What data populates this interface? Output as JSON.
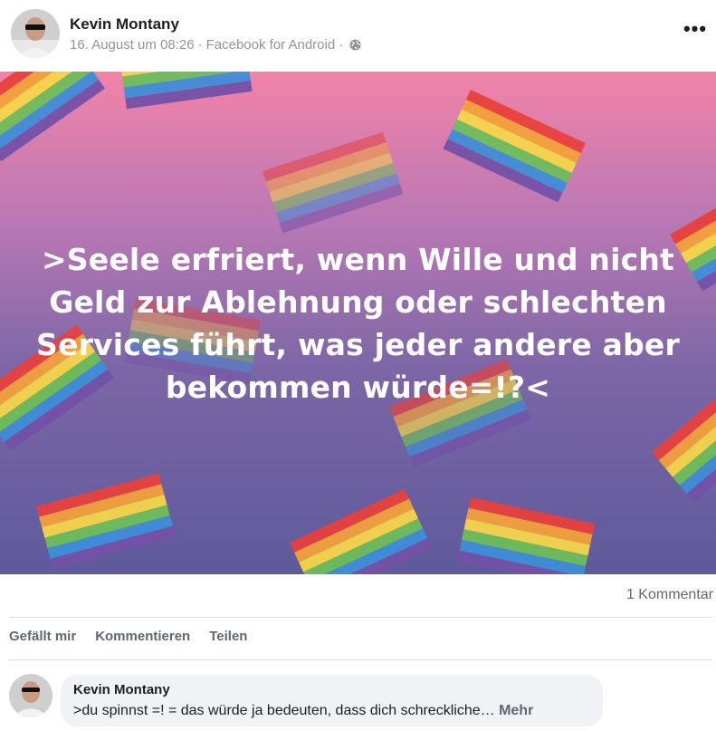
{
  "post": {
    "author": "Kevin Montany",
    "date": "16. August um 08:26",
    "separator": "·",
    "source": "Facebook for Android",
    "separator2": "·",
    "privacy_icon": "globe-icon",
    "more_icon": "more-options-icon",
    "image_text": ">Seele erfriert, wenn Wille und nicht Geld zur Ablehnung oder schlechten Services führt, was jeder andere aber bekommen würde=!?<",
    "comment_count_label": "1 Kommentar"
  },
  "actions": {
    "like": "Gefällt mir",
    "comment": "Kommentieren",
    "share": "Teilen"
  },
  "comment": {
    "author": "Kevin Montany",
    "text": ">du spinnst =! = das würde ja bedeuten, dass dich schreckliche…",
    "more_label": "Mehr"
  },
  "colors": {
    "text_primary": "#1c1e21",
    "text_secondary": "#606770",
    "meta": "#90949c",
    "bubble": "#f0f2f5",
    "bg_top": "#f283a8",
    "bg_bottom": "#5e5a9c"
  }
}
